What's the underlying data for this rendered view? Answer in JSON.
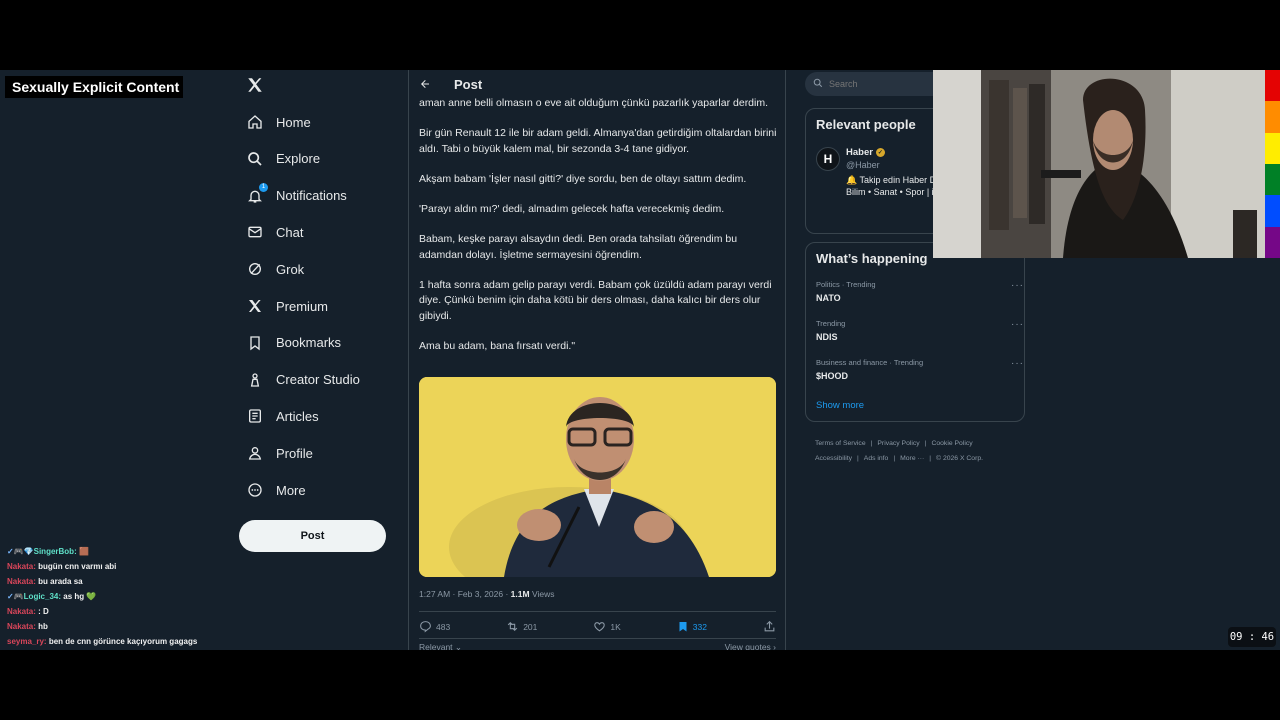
{
  "overlay": {
    "label": "Sexually Explicit Content"
  },
  "chat": [
    {
      "badges": "✓🎮💎",
      "user": "SingerBob:",
      "user_style": "teal",
      "msg": "🟫"
    },
    {
      "badges": "",
      "user": "Nakata:",
      "user_style": "red",
      "msg": "bugün cnn varmı abi"
    },
    {
      "badges": "",
      "user": "Nakata:",
      "user_style": "red",
      "msg": "bu arada sa"
    },
    {
      "badges": "✓🎮",
      "user": "Logic_34:",
      "user_style": "teal",
      "msg": "as hg 💚"
    },
    {
      "badges": "",
      "user": "Nakata:",
      "user_style": "red",
      "msg": ": D"
    },
    {
      "badges": "",
      "user": "Nakata:",
      "user_style": "red",
      "msg": "hb"
    },
    {
      "badges": "",
      "user": "seyma_ry:",
      "user_style": "red",
      "msg": "ben de cnn görünce kaçıyorum gagags"
    }
  ],
  "nav": {
    "items": [
      {
        "label": "Home",
        "icon": "home-icon"
      },
      {
        "label": "Explore",
        "icon": "search-icon"
      },
      {
        "label": "Notifications",
        "icon": "bell-icon",
        "badge": "1"
      },
      {
        "label": "Chat",
        "icon": "mail-icon"
      },
      {
        "label": "Grok",
        "icon": "grok-icon"
      },
      {
        "label": "Premium",
        "icon": "x-logo-icon"
      },
      {
        "label": "Bookmarks",
        "icon": "bookmark-icon"
      },
      {
        "label": "Creator Studio",
        "icon": "creator-icon"
      },
      {
        "label": "Articles",
        "icon": "articles-icon"
      },
      {
        "label": "Profile",
        "icon": "person-icon"
      },
      {
        "label": "More",
        "icon": "more-circle-icon"
      }
    ],
    "post_button": "Post"
  },
  "main": {
    "header_title": "Post",
    "paragraphs": [
      "aman anne belli olmasın o eve ait olduğum çünkü pazarlık yaparlar derdim.",
      "Bir gün Renault 12 ile bir adam geldi. Almanya'dan getirdiğim oltalardan birini aldı. Tabi o büyük kalem mal, bir sezonda 3-4 tane gidiyor.",
      "Akşam babam 'İşler nasıl gitti?' diye sordu, ben de oltayı sattım dedim.",
      "'Parayı aldın mı?' dedi, almadım gelecek hafta verecekmiş dedim.",
      "Babam, keşke parayı alsaydın dedi. Ben orada tahsilatı öğrendim bu adamdan dolayı. İşletme sermayesini öğrendim.",
      "1 hafta sonra adam gelip parayı verdi. Babam çok üzüldü adam parayı verdi diye. Çünkü benim için daha kötü bir ders olması, daha kalıcı bir ders olur gibiydi.",
      "Ama bu adam, bana fırsatı verdi.\""
    ],
    "meta": {
      "time": "1:27 AM · Feb 3, 2026 · ",
      "views_count": "1.1M",
      "views_label": " Views"
    },
    "actions": {
      "replies": "483",
      "reposts": "201",
      "likes": "1K",
      "bookmarks": "332"
    },
    "below": {
      "left": "Relevant",
      "right": "View quotes"
    }
  },
  "sidebar": {
    "search_placeholder": "Search",
    "relevant": {
      "title": "Relevant people",
      "avatar_letter": "H",
      "name": "Haber",
      "handle": "@Haber",
      "bio": "🔔 Takip edin Haber Dakika • Gündem • S Bilim • Sanat • Spor | iletisim@haber.news"
    },
    "happening": {
      "title": "What’s happening",
      "trends": [
        {
          "category": "Politics · Trending",
          "name": "NATO"
        },
        {
          "category": "Trending",
          "name": "NDIS"
        },
        {
          "category": "Business and finance · Trending",
          "name": "$HOOD"
        }
      ],
      "show_more": "Show more"
    },
    "footer": {
      "links1": [
        "Terms of Service",
        "Privacy Policy",
        "Cookie Policy"
      ],
      "links2": [
        "Accessibility",
        "Ads info",
        "More ···",
        "© 2026 X Corp."
      ]
    }
  },
  "clock": "09 : 46",
  "colors": {
    "background": "#15202b",
    "accent": "#1d9bf0",
    "rainbow": [
      "#e40303",
      "#ff8c00",
      "#ffed00",
      "#008026",
      "#004dff",
      "#750787"
    ]
  }
}
